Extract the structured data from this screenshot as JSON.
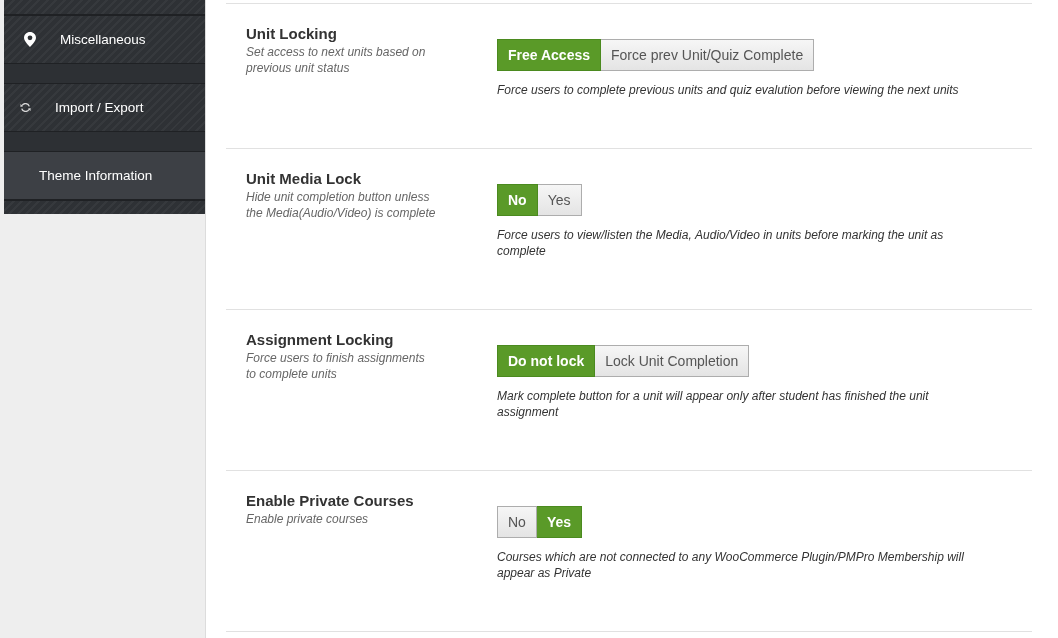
{
  "sidebar": {
    "items": [
      {
        "label": "Miscellaneous",
        "selected": false
      },
      {
        "label": "Import / Export",
        "selected": false
      },
      {
        "label": "Theme Information",
        "selected": true
      }
    ]
  },
  "settings": [
    {
      "title": "Unit Locking",
      "subtitle": "Set access to next units based on previous unit status",
      "options": [
        {
          "label": "Free Access",
          "selected": true
        },
        {
          "label": "Force prev Unit/Quiz Complete",
          "selected": false
        }
      ],
      "description": "Force users to complete previous units and quiz evalution before viewing the next units"
    },
    {
      "title": "Unit Media Lock",
      "subtitle": "Hide unit completion button unless the Media(Audio/Video) is complete",
      "options": [
        {
          "label": "No",
          "selected": true
        },
        {
          "label": "Yes",
          "selected": false
        }
      ],
      "description": "Force users to view/listen the Media, Audio/Video in units before marking the unit as complete"
    },
    {
      "title": "Assignment Locking",
      "subtitle": "Force users to finish assignments to complete units",
      "options": [
        {
          "label": "Do not lock",
          "selected": true
        },
        {
          "label": "Lock Unit Completion",
          "selected": false
        }
      ],
      "description": "Mark complete button for a unit will appear only after student has finished the unit assignment"
    },
    {
      "title": "Enable Private Courses",
      "subtitle": "Enable private courses",
      "options": [
        {
          "label": "No",
          "selected": false
        },
        {
          "label": "Yes",
          "selected": true
        }
      ],
      "description": "Courses which are not connected to any WooCommerce Plugin/PMPro Membership will appear as Private"
    }
  ]
}
